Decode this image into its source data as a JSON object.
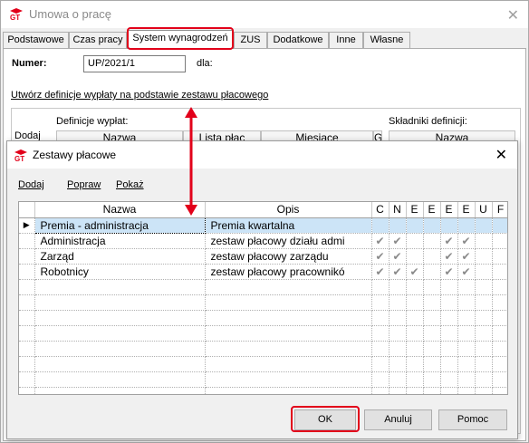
{
  "window": {
    "title": "Umowa o pracę"
  },
  "tabs": [
    {
      "label": "Podstawowe"
    },
    {
      "label": "Czas pracy"
    },
    {
      "label": "System wynagrodzeń"
    },
    {
      "label": "ZUS"
    },
    {
      "label": "Dodatkowe"
    },
    {
      "label": "Inne"
    },
    {
      "label": "Własne"
    }
  ],
  "form": {
    "numer_label": "Numer:",
    "numer_value": "UP/2021/1",
    "dla_label": "dla:",
    "link": "Utwórz definicje wypłaty na podstawie zestawu płacowego"
  },
  "background": {
    "definicje_label": "Definicje wypłat:",
    "skladniki_label": "Składniki definicji:",
    "dodaj": "Dodaj",
    "col_nazwa": "Nazwa",
    "col_lista_plac": "Lista płac",
    "col_miesiace": "Miesiące",
    "col_g": "G",
    "col_nazwa2": "Nazwa"
  },
  "dialog": {
    "title": "Zestawy płacowe",
    "links": {
      "dodaj": "Dodaj",
      "popraw": "Popraw",
      "pokaz": "Pokaż"
    },
    "columns": [
      "Nazwa",
      "Opis",
      "C",
      "N",
      "E",
      "E",
      "E",
      "E",
      "U",
      "F"
    ],
    "rows": [
      {
        "nazwa": "Premia - administracja",
        "opis": "Premia kwartalna",
        "checks": [
          false,
          false,
          false,
          false,
          false,
          false,
          false,
          false
        ]
      },
      {
        "nazwa": "Administracja",
        "opis": "zestaw płacowy działu admi",
        "checks": [
          true,
          true,
          false,
          false,
          true,
          true,
          false,
          false
        ]
      },
      {
        "nazwa": "Zarząd",
        "opis": "zestaw płacowy zarządu",
        "checks": [
          true,
          true,
          false,
          false,
          true,
          true,
          false,
          false
        ]
      },
      {
        "nazwa": "Robotnicy",
        "opis": "zestaw płacowy pracownikó",
        "checks": [
          true,
          true,
          true,
          false,
          true,
          true,
          false,
          false
        ]
      }
    ],
    "selected_row": 0,
    "empty_rows": 8,
    "buttons": {
      "ok": "OK",
      "anuluj": "Anuluj",
      "pomoc": "Pomoc"
    }
  },
  "colors": {
    "highlight": "#e2001a",
    "selection": "#cce4f7",
    "check": "#8a8a8a"
  },
  "icons": {
    "app_logo": "gt-logo-icon",
    "close": "close-icon",
    "row_pointer": "row-pointer-icon",
    "check": "check-icon"
  }
}
